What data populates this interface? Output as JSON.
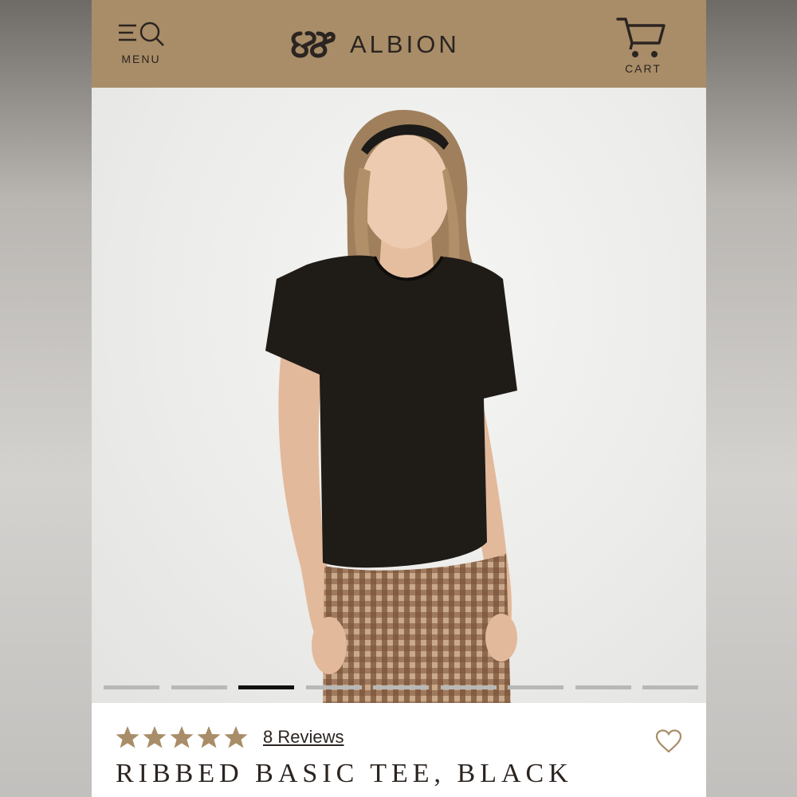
{
  "header": {
    "menu_label": "MENU",
    "brand_name": "ALBION",
    "cart_label": "CART",
    "background_color": "#a88d68"
  },
  "hero": {
    "carousel": {
      "slide_count": 9,
      "active_index": 2
    }
  },
  "product": {
    "rating": 5,
    "reviews_label": "8 Reviews",
    "title": "RIBBED BASIC TEE, BLACK",
    "star_color": "#a88d68"
  },
  "icons": [
    "menu-search-icon",
    "brand-logo-mark",
    "cart-icon",
    "star-icon",
    "heart-icon"
  ]
}
